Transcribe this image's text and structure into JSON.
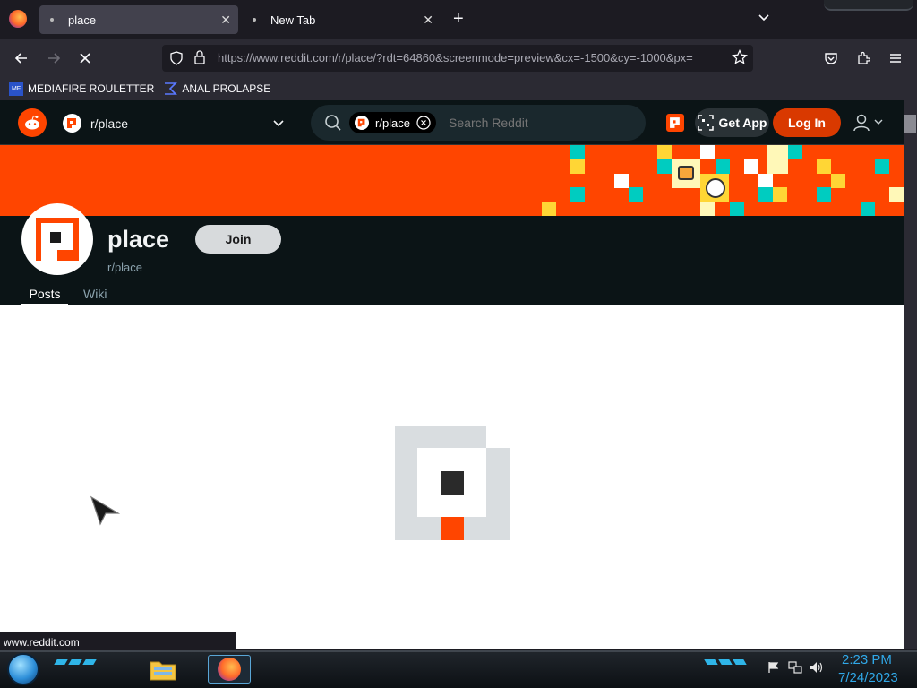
{
  "browser": {
    "tabs": [
      {
        "label": "place",
        "active": true
      },
      {
        "label": "New Tab",
        "active": false
      }
    ],
    "new_tab_symbol": "+",
    "url": "https://www.reddit.com/r/place/?rdt=64860&screenmode=preview&cx=-1500&cy=-1000&px=",
    "bookmarks": [
      {
        "label": "MEDIAFIRE ROULETTER",
        "icon": "mediafire-icon"
      },
      {
        "label": "ANAL PROLAPSE",
        "icon": "sigma-icon"
      }
    ],
    "status_text": "www.reddit.com"
  },
  "reddit": {
    "community_selector": "r/place",
    "search_chip": "r/place",
    "search_placeholder": "Search Reddit",
    "get_app": "Get App",
    "login": "Log In",
    "sub_title": "place",
    "sub_name": "r/place",
    "join": "Join",
    "tabs": [
      "Posts",
      "Wiki"
    ],
    "colors": {
      "brand": "#ff4500",
      "teal": "#00ccc0",
      "yellow": "#ffd635"
    }
  },
  "taskbar": {
    "time": "2:23 PM",
    "date": "7/24/2023"
  }
}
